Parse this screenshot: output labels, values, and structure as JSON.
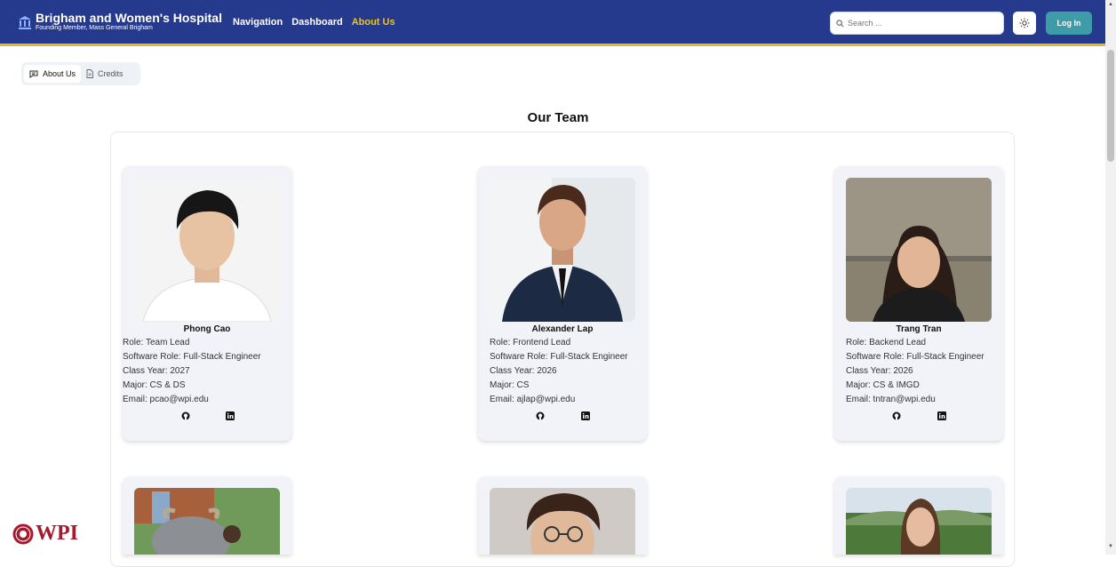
{
  "header": {
    "brand_title": "Brigham and Women's Hospital",
    "brand_subtitle": "Founding Member, Mass General Brigham",
    "nav": [
      "Navigation",
      "Dashboard",
      "About Us"
    ],
    "search_placeholder": "Search ...",
    "login_label": "Log In"
  },
  "tabs": [
    "About Us",
    "Credits"
  ],
  "page_title": "Our Team",
  "members": [
    {
      "name": "Phong Cao",
      "role": "Role: Team Lead",
      "software_role": "Software Role: Full-Stack Engineer",
      "class_year": "Class Year: 2027",
      "major": "Major: CS & DS",
      "email": "Email: pcao@wpi.edu"
    },
    {
      "name": "Alexander Lap",
      "role": "Role: Frontend Lead",
      "software_role": "Software Role: Full-Stack Engineer",
      "class_year": "Class Year: 2026",
      "major": "Major: CS",
      "email": "Email: ajlap@wpi.edu"
    },
    {
      "name": "Trang Tran",
      "role": "Role: Backend Lead",
      "software_role": "Software Role: Full-Stack Engineer",
      "class_year": "Class Year: 2026",
      "major": "Major: CS & IMGD",
      "email": "Email: tntran@wpi.edu"
    }
  ],
  "footer_logo": "WPI",
  "colors": {
    "header_bg": "#253a8c",
    "accent": "#e8b923",
    "login_bg": "#3d9ca8",
    "wpi_red": "#a6192e"
  }
}
